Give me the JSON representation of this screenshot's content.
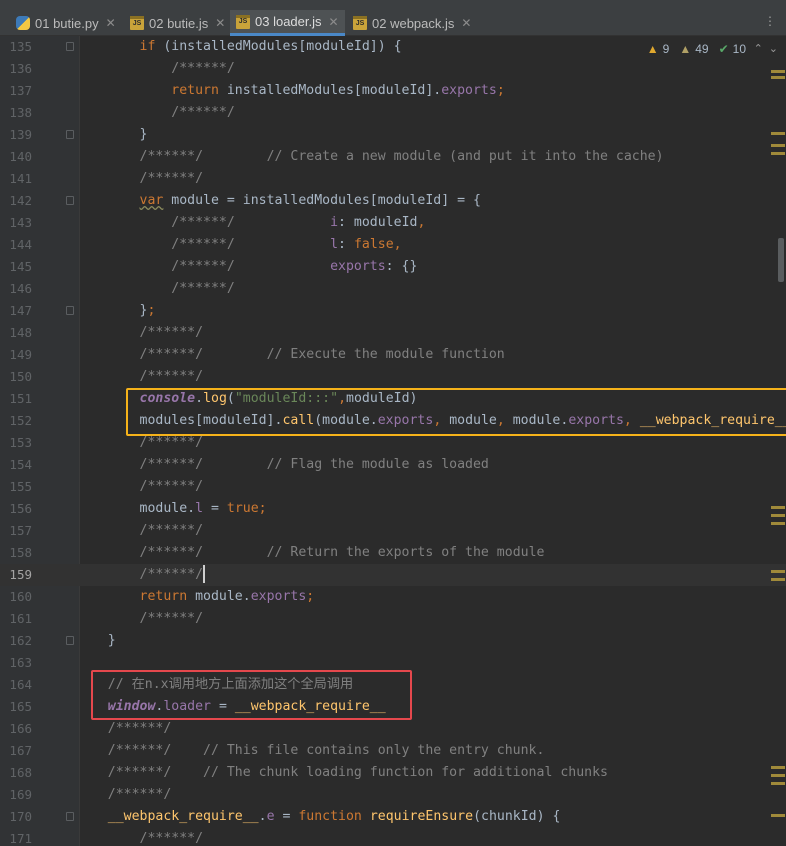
{
  "tabs": [
    {
      "label": "01 butie.py",
      "icon": "python-file-icon",
      "type": "py",
      "active": false
    },
    {
      "label": "02 butie.js",
      "icon": "js-file-icon",
      "type": "js",
      "active": false
    },
    {
      "label": "03 loader.js",
      "icon": "js-file-icon",
      "type": "js",
      "active": true
    },
    {
      "label": "02 webpack.js",
      "icon": "js-file-icon",
      "type": "js",
      "active": false
    }
  ],
  "tab_more": "⋮",
  "inspection": {
    "warnings": "9",
    "weak_warnings": "49",
    "typos": "10"
  },
  "lines": [
    {
      "n": "135",
      "tokens": [
        [
          "",
          "        "
        ],
        [
          "kw",
          "if"
        ],
        [
          "",
          " (installedModules[moduleId]) {"
        ]
      ]
    },
    {
      "n": "136",
      "tokens": [
        [
          "",
          "            "
        ],
        [
          "cmt",
          "/******/"
        ]
      ]
    },
    {
      "n": "137",
      "tokens": [
        [
          "",
          "            "
        ],
        [
          "kw",
          "return"
        ],
        [
          "",
          " installedModules[moduleId]."
        ],
        [
          "fld",
          "exports"
        ],
        [
          "kw",
          ";"
        ]
      ]
    },
    {
      "n": "138",
      "tokens": [
        [
          "",
          "            "
        ],
        [
          "cmt",
          "/******/"
        ]
      ]
    },
    {
      "n": "139",
      "tokens": [
        [
          "",
          "        }"
        ]
      ]
    },
    {
      "n": "140",
      "tokens": [
        [
          "",
          "        "
        ],
        [
          "cmt",
          "/******/        // Create a new module (and put it into the cache)"
        ]
      ]
    },
    {
      "n": "141",
      "tokens": [
        [
          "",
          "        "
        ],
        [
          "cmt",
          "/******/"
        ]
      ]
    },
    {
      "n": "142",
      "tokens": [
        [
          "",
          "        "
        ],
        [
          "kw squig",
          "var"
        ],
        [
          "",
          " module = installedModules[moduleId] = {"
        ]
      ]
    },
    {
      "n": "143",
      "tokens": [
        [
          "",
          "            "
        ],
        [
          "cmt",
          "/******/"
        ],
        [
          "",
          "            "
        ],
        [
          "fld",
          "i"
        ],
        [
          "",
          ": moduleId"
        ],
        [
          "kw",
          ","
        ]
      ]
    },
    {
      "n": "144",
      "tokens": [
        [
          "",
          "            "
        ],
        [
          "cmt",
          "/******/"
        ],
        [
          "",
          "            "
        ],
        [
          "fld",
          "l"
        ],
        [
          "",
          ": "
        ],
        [
          "kw",
          "false,"
        ]
      ]
    },
    {
      "n": "145",
      "tokens": [
        [
          "",
          "            "
        ],
        [
          "cmt",
          "/******/"
        ],
        [
          "",
          "            "
        ],
        [
          "fld",
          "exports"
        ],
        [
          "",
          ": {}"
        ]
      ]
    },
    {
      "n": "146",
      "tokens": [
        [
          "",
          "            "
        ],
        [
          "cmt",
          "/******/"
        ]
      ]
    },
    {
      "n": "147",
      "tokens": [
        [
          "",
          "        }"
        ],
        [
          "kw",
          ";"
        ]
      ]
    },
    {
      "n": "148",
      "tokens": [
        [
          "",
          "        "
        ],
        [
          "cmt",
          "/******/"
        ]
      ]
    },
    {
      "n": "149",
      "tokens": [
        [
          "",
          "        "
        ],
        [
          "cmt",
          "/******/        // Execute the module function"
        ]
      ]
    },
    {
      "n": "150",
      "tokens": [
        [
          "",
          "        "
        ],
        [
          "cmt",
          "/******/"
        ]
      ]
    },
    {
      "n": "151",
      "tokens": [
        [
          "",
          "        "
        ],
        [
          "glob",
          "console"
        ],
        [
          "",
          "."
        ],
        [
          "fn",
          "log"
        ],
        [
          "",
          "("
        ],
        [
          "str",
          "\"moduleId:::\""
        ],
        [
          "kw",
          ","
        ],
        [
          "",
          "moduleId)"
        ]
      ]
    },
    {
      "n": "152",
      "tokens": [
        [
          "",
          "        modules[moduleId]."
        ],
        [
          "fn",
          "call"
        ],
        [
          "",
          "(module."
        ],
        [
          "fld",
          "exports"
        ],
        [
          "kw",
          ","
        ],
        [
          "",
          " module"
        ],
        [
          "kw",
          ","
        ],
        [
          "",
          " module."
        ],
        [
          "fld",
          "exports"
        ],
        [
          "kw",
          ","
        ],
        [
          "",
          " "
        ],
        [
          "fn",
          "__webpack_require__"
        ],
        [
          "",
          ")"
        ]
      ]
    },
    {
      "n": "153",
      "tokens": [
        [
          "",
          "        "
        ],
        [
          "cmt",
          "/******/"
        ]
      ]
    },
    {
      "n": "154",
      "tokens": [
        [
          "",
          "        "
        ],
        [
          "cmt",
          "/******/        // Flag the module as loaded"
        ]
      ]
    },
    {
      "n": "155",
      "tokens": [
        [
          "",
          "        "
        ],
        [
          "cmt",
          "/******/"
        ]
      ]
    },
    {
      "n": "156",
      "tokens": [
        [
          "",
          "        module."
        ],
        [
          "fld",
          "l"
        ],
        [
          "",
          " = "
        ],
        [
          "kw",
          "true;"
        ]
      ]
    },
    {
      "n": "157",
      "tokens": [
        [
          "",
          "        "
        ],
        [
          "cmt",
          "/******/"
        ]
      ]
    },
    {
      "n": "158",
      "tokens": [
        [
          "",
          "        "
        ],
        [
          "cmt",
          "/******/        // Return the exports of the module"
        ]
      ]
    },
    {
      "n": "159",
      "tokens": [
        [
          "",
          "        "
        ],
        [
          "cmt",
          "/******/"
        ]
      ],
      "caret": true
    },
    {
      "n": "160",
      "tokens": [
        [
          "",
          "        "
        ],
        [
          "kw",
          "return"
        ],
        [
          "",
          " module."
        ],
        [
          "fld",
          "exports"
        ],
        [
          "kw",
          ";"
        ]
      ]
    },
    {
      "n": "161",
      "tokens": [
        [
          "",
          "        "
        ],
        [
          "cmt",
          "/******/"
        ]
      ]
    },
    {
      "n": "162",
      "tokens": [
        [
          "",
          "    }"
        ]
      ]
    },
    {
      "n": "163",
      "tokens": [
        [
          "",
          ""
        ]
      ]
    },
    {
      "n": "164",
      "tokens": [
        [
          "",
          "    "
        ],
        [
          "cmt",
          "// 在n.x调用地方上面添加这个全局调用"
        ]
      ]
    },
    {
      "n": "165",
      "tokens": [
        [
          "",
          "    "
        ],
        [
          "glob",
          "window"
        ],
        [
          "",
          "."
        ],
        [
          "fld",
          "loader"
        ],
        [
          "",
          " = "
        ],
        [
          "fn",
          "__webpack_require__"
        ]
      ]
    },
    {
      "n": "166",
      "tokens": [
        [
          "",
          "    "
        ],
        [
          "cmt",
          "/******/"
        ]
      ]
    },
    {
      "n": "167",
      "tokens": [
        [
          "",
          "    "
        ],
        [
          "cmt",
          "/******/    // This file contains only the entry chunk."
        ]
      ]
    },
    {
      "n": "168",
      "tokens": [
        [
          "",
          "    "
        ],
        [
          "cmt",
          "/******/    // The chunk loading function for additional chunks"
        ]
      ]
    },
    {
      "n": "169",
      "tokens": [
        [
          "",
          "    "
        ],
        [
          "cmt",
          "/******/"
        ]
      ]
    },
    {
      "n": "170",
      "tokens": [
        [
          "",
          "    "
        ],
        [
          "fn",
          "__webpack_require__"
        ],
        [
          "",
          "."
        ],
        [
          "fld",
          "e"
        ],
        [
          "",
          " = "
        ],
        [
          "kw",
          "function"
        ],
        [
          "",
          " "
        ],
        [
          "fn",
          "requireEnsure"
        ],
        [
          "",
          "(chunkId) {"
        ]
      ]
    },
    {
      "n": "171",
      "tokens": [
        [
          "",
          "        "
        ],
        [
          "cmt",
          "/******/"
        ]
      ]
    }
  ],
  "colors": {
    "keyword": "#cc7832",
    "field": "#9876aa",
    "comment": "#808080",
    "string": "#6a8759",
    "function": "#ffc66d",
    "text": "#a9b7c6",
    "highlight_yellow": "#f5b21a",
    "highlight_red": "#e5484d"
  }
}
